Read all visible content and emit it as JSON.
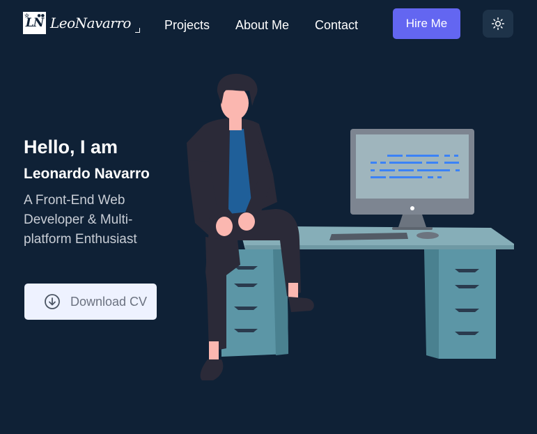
{
  "brand": {
    "logo_mark": "LN",
    "name": "LeoNavarro"
  },
  "nav": {
    "links": [
      {
        "label": "Projects"
      },
      {
        "label": "About Me"
      },
      {
        "label": "Contact"
      }
    ],
    "hire_label": "Hire Me",
    "theme_toggle_icon": "sun-icon"
  },
  "hero": {
    "greeting": "Hello, I am",
    "name": "Leonardo Navarro",
    "description": "A Front-End Web Developer & Multi-platform Enthusiast",
    "cta_label": "Download CV",
    "cta_icon": "download-icon"
  },
  "colors": {
    "background": "#0f2136",
    "accent": "#6366f1",
    "cta_bg": "#eef2ff",
    "desk": "#86aeb8",
    "drawers": "#5c96a6"
  }
}
